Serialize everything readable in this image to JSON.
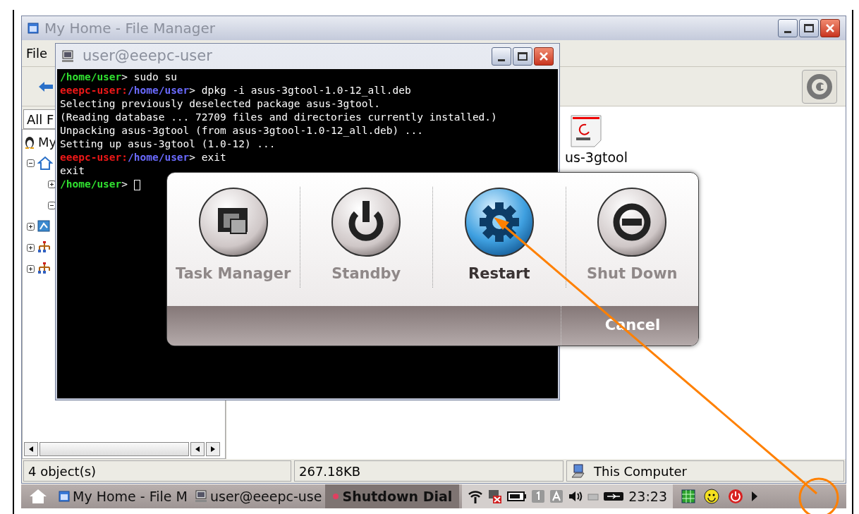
{
  "file_manager": {
    "title": "My Home - File Manager",
    "menu": [
      {
        "label": "File"
      }
    ],
    "pane_tab": "All F",
    "tree": [
      {
        "label": "My",
        "expanded": true,
        "children": [
          {
            "expanded": true,
            "children": [
              {
                "expanded": false
              },
              {
                "expanded": true
              }
            ]
          },
          {
            "expanded": false
          },
          {
            "expanded": false
          },
          {
            "expanded": false
          }
        ]
      }
    ],
    "files": [
      {
        "name": "us-3gtool"
      }
    ],
    "status_bar": [
      "4 object(s)",
      "267.18KB",
      "This Computer"
    ]
  },
  "terminal": {
    "title": "user@eeepc-user",
    "lines": [
      {
        "kind": "user_prompt",
        "path": "/home/user",
        "text": "> sudo su"
      },
      {
        "kind": "root_prompt",
        "host": "eeepc-user:",
        "path": "/home/user",
        "text": "> dpkg -i asus-3gtool-1.0-12_all.deb"
      },
      {
        "kind": "output",
        "text": "Selecting previously deselected package asus-3gtool."
      },
      {
        "kind": "output",
        "text": "(Reading database ... 72709 files and directories currently installed.)"
      },
      {
        "kind": "output",
        "text": "Unpacking asus-3gtool (from asus-3gtool-1.0-12_all.deb) ..."
      },
      {
        "kind": "output",
        "text": "Setting up asus-3gtool (1.0-12) ..."
      },
      {
        "kind": "root_prompt",
        "host": "eeepc-user:",
        "path": "/home/user",
        "text": "> exit"
      },
      {
        "kind": "output",
        "text": "exit"
      },
      {
        "kind": "user_prompt",
        "path": "/home/user",
        "text": "> ",
        "cursor": true
      }
    ]
  },
  "shutdown_dialog": {
    "options": [
      {
        "kind": "task_manager",
        "label": "Task Manager",
        "selected": false
      },
      {
        "kind": "standby",
        "label": "Standby",
        "selected": false
      },
      {
        "kind": "restart",
        "label": "Restart",
        "selected": true
      },
      {
        "kind": "shut_down",
        "label": "Shut Down",
        "selected": false
      }
    ],
    "cancel": {
      "label": "Cancel"
    }
  },
  "taskbar": {
    "tasks": [
      {
        "kind": "file_manager",
        "label": "My Home - File M",
        "selected": false
      },
      {
        "kind": "terminal",
        "label": "user@eeepc-use",
        "selected": false
      },
      {
        "kind": "dialog",
        "label": "Shutdown Dial",
        "selected": true
      }
    ],
    "clock": "23:23"
  }
}
